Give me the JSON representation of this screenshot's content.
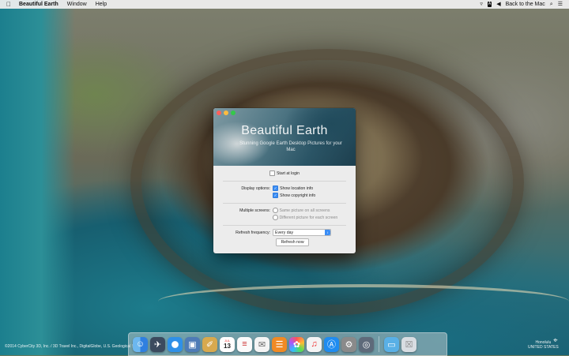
{
  "menubar": {
    "apple_icon": "apple-icon",
    "app_name": "Beautiful Earth",
    "menus": [
      "Window",
      "Help"
    ],
    "keyboard_badge": "A",
    "user_name": "Back to the Mac"
  },
  "window": {
    "title": "Beautiful Earth",
    "subtitle": "Stunning Google Earth Desktop Pictures for your Mac",
    "start_at_login": "Start at login",
    "display_options_label": "Display options:",
    "show_location_info": "Show location info",
    "show_copyright_info": "Show copyright info",
    "multiple_screens_label": "Multiple screens:",
    "same_picture": "Same picture on all screens",
    "different_picture": "Different picture for each screen",
    "refresh_label": "Refresh frequency:",
    "refresh_value": "Every day",
    "refresh_button": "Refresh now",
    "start_at_login_checked": false,
    "show_location_checked": true,
    "show_copyright_checked": true,
    "multiple_screens_selected": "different"
  },
  "dock": {
    "apps": [
      "finder-icon",
      "launchpad-icon",
      "safari-icon",
      "preview-icon",
      "notes-icon",
      "calendar-icon",
      "reminders-icon",
      "contacts-icon",
      "books-icon",
      "photos-icon",
      "itunes-icon",
      "app-store-icon",
      "system-preferences-icon",
      "disk-utility-icon",
      "folder-icon",
      "trash-icon"
    ],
    "calendar_month": "JUL",
    "calendar_day": "13"
  },
  "desktop": {
    "copyright": "©2014 CyberCity 3D, Inc. / 3D Travel Inc., DigitalGlobe, U.S. Geological Survey",
    "location_city": "Honolulu",
    "location_country": "UNITED STATES"
  }
}
